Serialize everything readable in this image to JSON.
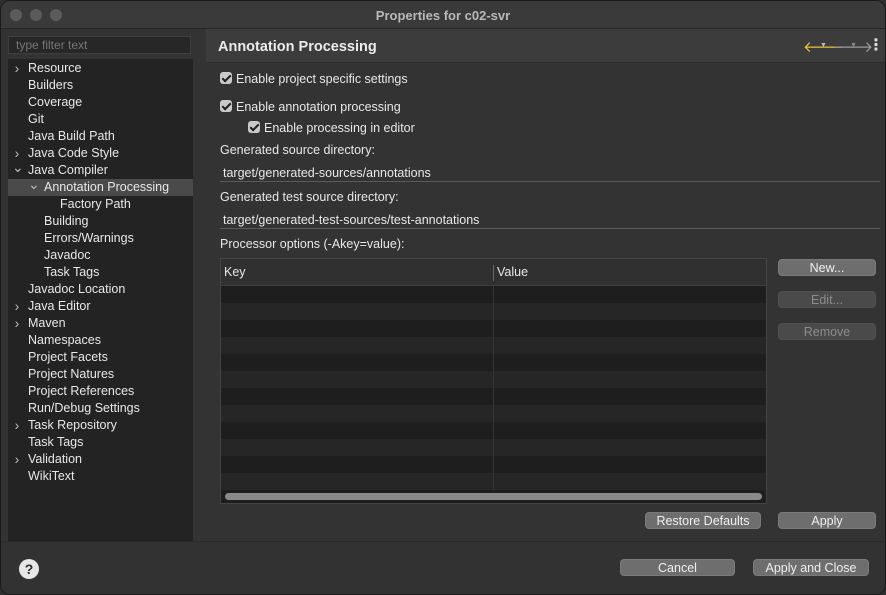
{
  "window": {
    "title": "Properties for c02-svr"
  },
  "filter": {
    "placeholder": "type filter text"
  },
  "tree": {
    "items": [
      {
        "label": "Resource",
        "chevron": "right",
        "depth": 0
      },
      {
        "label": "Builders",
        "chevron": "",
        "depth": 0
      },
      {
        "label": "Coverage",
        "chevron": "",
        "depth": 0
      },
      {
        "label": "Git",
        "chevron": "",
        "depth": 0
      },
      {
        "label": "Java Build Path",
        "chevron": "",
        "depth": 0
      },
      {
        "label": "Java Code Style",
        "chevron": "right",
        "depth": 0
      },
      {
        "label": "Java Compiler",
        "chevron": "down",
        "depth": 0
      },
      {
        "label": "Annotation Processing",
        "chevron": "down",
        "depth": 1,
        "selected": true
      },
      {
        "label": "Factory Path",
        "chevron": "",
        "depth": 2
      },
      {
        "label": "Building",
        "chevron": "",
        "depth": 1
      },
      {
        "label": "Errors/Warnings",
        "chevron": "",
        "depth": 1
      },
      {
        "label": "Javadoc",
        "chevron": "",
        "depth": 1
      },
      {
        "label": "Task Tags",
        "chevron": "",
        "depth": 1
      },
      {
        "label": "Javadoc Location",
        "chevron": "",
        "depth": 0
      },
      {
        "label": "Java Editor",
        "chevron": "right",
        "depth": 0
      },
      {
        "label": "Maven",
        "chevron": "right",
        "depth": 0
      },
      {
        "label": "Namespaces",
        "chevron": "",
        "depth": 0
      },
      {
        "label": "Project Facets",
        "chevron": "",
        "depth": 0
      },
      {
        "label": "Project Natures",
        "chevron": "",
        "depth": 0
      },
      {
        "label": "Project References",
        "chevron": "",
        "depth": 0
      },
      {
        "label": "Run/Debug Settings",
        "chevron": "",
        "depth": 0
      },
      {
        "label": "Task Repository",
        "chevron": "right",
        "depth": 0
      },
      {
        "label": "Task Tags",
        "chevron": "",
        "depth": 0
      },
      {
        "label": "Validation",
        "chevron": "right",
        "depth": 0
      },
      {
        "label": "WikiText",
        "chevron": "",
        "depth": 0
      }
    ]
  },
  "page": {
    "title": "Annotation Processing",
    "nav": {
      "back_icon": "back-arrow-icon",
      "forward_icon": "forward-arrow-icon",
      "menu_icon": "view-menu-icon"
    },
    "enable_project_specific": {
      "label": "Enable project specific settings",
      "checked": true
    },
    "enable_annotation_processing": {
      "label": "Enable annotation processing",
      "checked": true
    },
    "enable_processing_in_editor": {
      "label": "Enable processing in editor",
      "checked": true
    },
    "generated_source_dir": {
      "label": "Generated source directory:",
      "value": "target/generated-sources/annotations"
    },
    "generated_test_source_dir": {
      "label": "Generated test source directory:",
      "value": "target/generated-test-sources/test-annotations"
    },
    "processor_options": {
      "label": "Processor options (-Akey=value):",
      "columns": [
        "Key",
        "Value"
      ],
      "rows": []
    },
    "buttons": {
      "new": "New...",
      "edit": "Edit...",
      "remove": "Remove"
    },
    "restore_defaults": "Restore Defaults",
    "apply": "Apply"
  },
  "footer": {
    "help_icon": "help-icon",
    "cancel": "Cancel",
    "apply_and_close": "Apply and Close"
  }
}
